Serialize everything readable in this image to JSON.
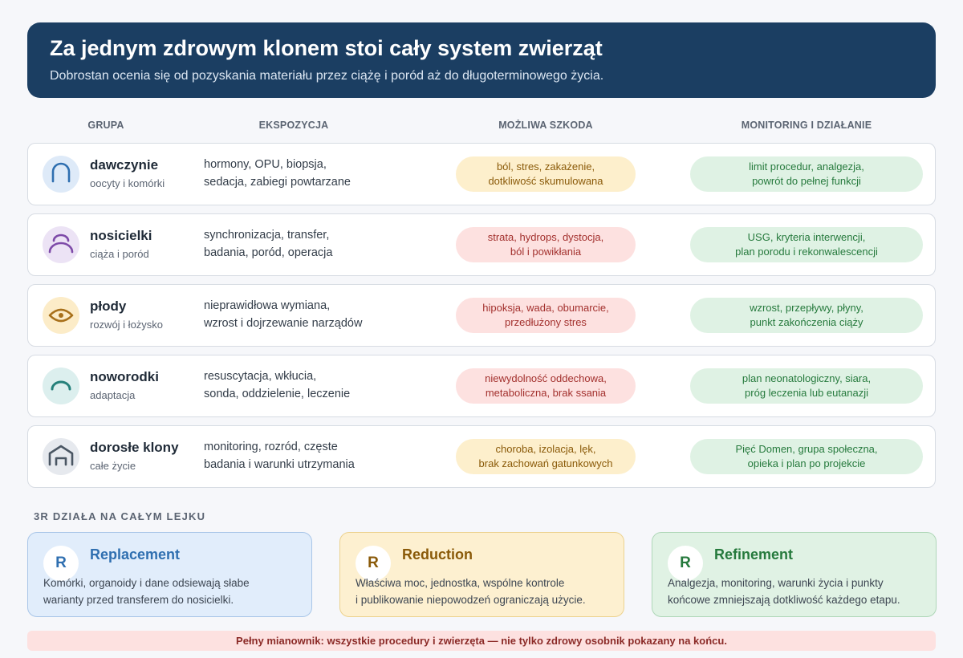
{
  "header": {
    "title": "Za jednym zdrowym klonem stoi cały system zwierząt",
    "subtitle": "Dobrostan ocenia się od pozyskania materiału przez ciążę i poród aż do długoterminowego życia."
  },
  "columns": {
    "group": "GRUPA",
    "exposure": "EKSPOZYCJA",
    "harm": "MOŻLIWA SZKODA",
    "monitoring": "MONITORING I DZIAŁANIE"
  },
  "rows": [
    {
      "title": "dawczynie",
      "subtitle": "oocyty i komórki",
      "icon": "arch-icon",
      "icon_color": "#2f6fb0",
      "icon_bg": "#deeaf8",
      "exposure": [
        "hormony, OPU, biopsja,",
        "sedacja, zabiegi powtarzane"
      ],
      "harm": [
        "ból, stres, zakażenie,",
        "dotkliwość skumulowana"
      ],
      "harm_level": "amber",
      "monitoring": [
        "limit procedur, analgezja,",
        "powrót do pełnej funkcji"
      ]
    },
    {
      "title": "nosicielki",
      "subtitle": "ciąża i poród",
      "icon": "pregnancy-icon",
      "icon_color": "#7d4aa8",
      "icon_bg": "#ece3f5",
      "exposure": [
        "synchronizacja, transfer,",
        "badania, poród, operacja"
      ],
      "harm": [
        "strata, hydrops, dystocja,",
        "ból i powikłania"
      ],
      "harm_level": "red",
      "monitoring": [
        "USG, kryteria interwencji,",
        "plan porodu i rekonwalescencji"
      ]
    },
    {
      "title": "płody",
      "subtitle": "rozwój i łożysko",
      "icon": "eye-icon",
      "icon_color": "#a8701a",
      "icon_bg": "#fcecc8",
      "exposure": [
        "nieprawidłowa wymiana,",
        "wzrost i dojrzewanie narządów"
      ],
      "harm": [
        "hipoksja, wada, obumarcie,",
        "przedłużony stres"
      ],
      "harm_level": "red",
      "monitoring": [
        "wzrost, przepływy, płyny,",
        "punkt zakończenia ciąży"
      ]
    },
    {
      "title": "noworodki",
      "subtitle": "adaptacja",
      "icon": "dome-icon",
      "icon_color": "#24807a",
      "icon_bg": "#dcefee",
      "exposure": [
        "resuscytacja, wkłucia,",
        "sonda, oddzielenie, leczenie"
      ],
      "harm": [
        "niewydolność oddechowa,",
        "metaboliczna, brak ssania"
      ],
      "harm_level": "red",
      "monitoring": [
        "plan neonatologiczny, siara,",
        "próg leczenia lub eutanazji"
      ]
    },
    {
      "title": "dorosłe klony",
      "subtitle": "całe życie",
      "icon": "barn-icon",
      "icon_color": "#4a5663",
      "icon_bg": "#e6e9ee",
      "exposure": [
        "monitoring, rozród, częste",
        "badania i warunki utrzymania"
      ],
      "harm": [
        "choroba, izolacja, lęk,",
        "brak zachowań gatunkowych"
      ],
      "harm_level": "amber",
      "monitoring": [
        "Pięć Domen, grupa społeczna,",
        "opieka i plan po projekcie"
      ]
    }
  ],
  "section_title": "3R DZIAŁA NA CAŁYM LEJKU",
  "principles": [
    {
      "badge": "R",
      "title": "Replacement",
      "text": [
        "Komórki, organoidy i dane odsiewają słabe",
        "warianty przed transferem do nosicielki."
      ],
      "accent": "#2f6fb0",
      "bg": "#e1edfb",
      "border": "#a9c6e8"
    },
    {
      "badge": "R",
      "title": "Reduction",
      "text": [
        "Właściwa moc, jednostka, wspólne kontrole",
        "i publikowanie niepowodzeń ograniczają użycie."
      ],
      "accent": "#8a5a09",
      "bg": "#fdf0d0",
      "border": "#ecd28f"
    },
    {
      "badge": "R",
      "title": "Refinement",
      "text": [
        "Analgezja, monitoring, warunki życia i punkty",
        "końcowe zmniejszają dotkliwość każdego etapu."
      ],
      "accent": "#267a3d",
      "bg": "#e0f2e4",
      "border": "#afd7b8"
    }
  ],
  "footer": "Pełny mianownik: wszystkie procedury i zwierzęta — nie tylko zdrowy osobnik pokazany na końcu."
}
